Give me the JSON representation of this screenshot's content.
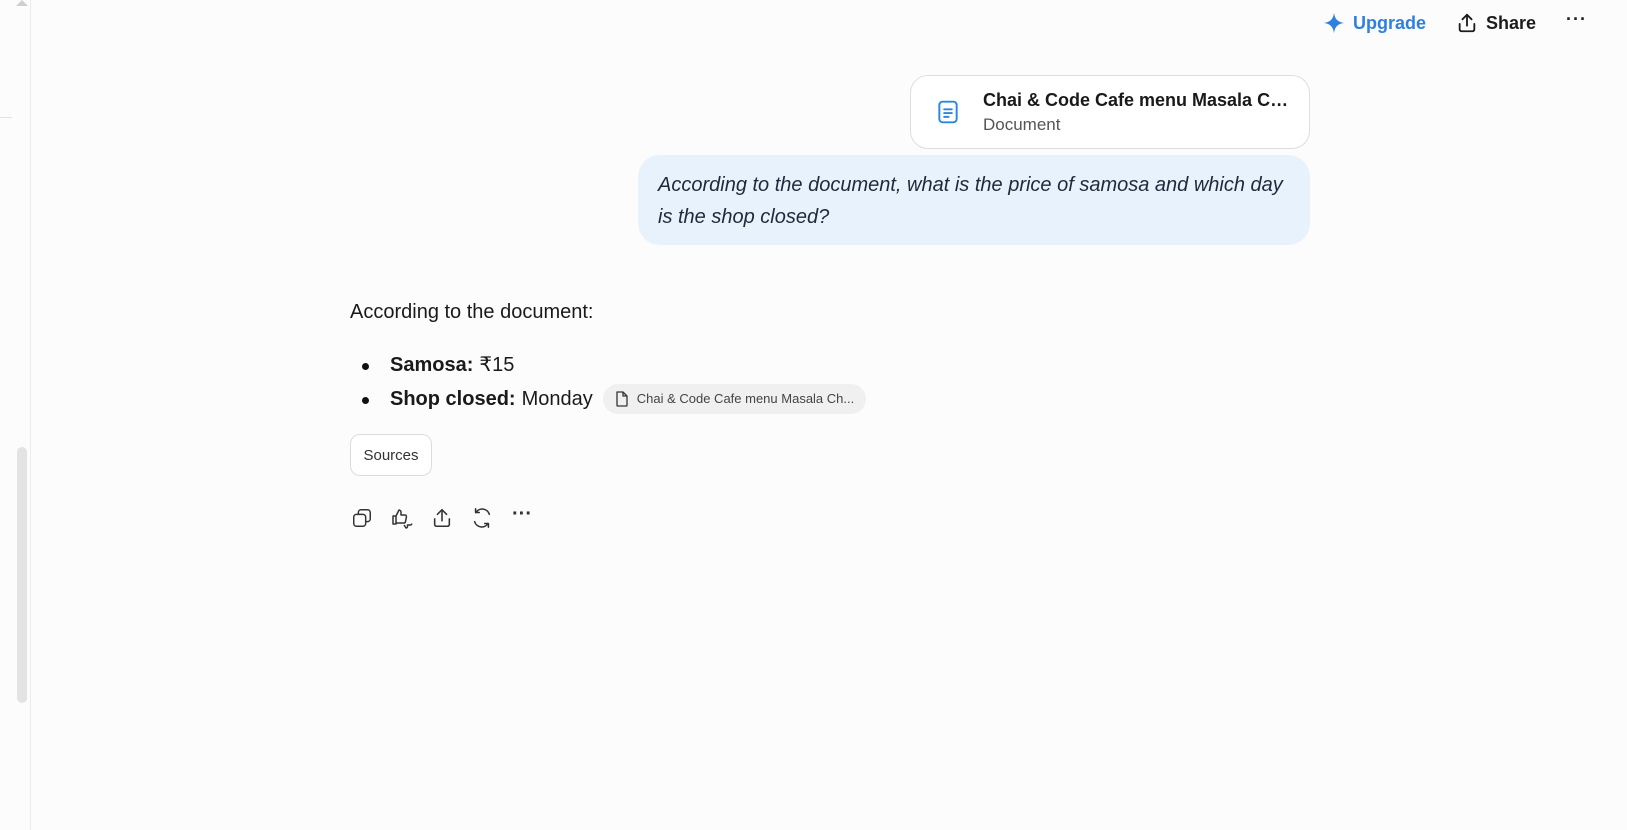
{
  "topbar": {
    "upgrade_label": "Upgrade",
    "share_label": "Share",
    "more_label": "···"
  },
  "attachment": {
    "title": "Chai & Code Cafe menu Masala Chai ...",
    "type": "Document"
  },
  "user_message": {
    "text": "According to the document, what is the price of samosa and which day is the shop closed?"
  },
  "answer": {
    "intro": "According to the document:",
    "items": [
      {
        "label": "Samosa:",
        "value": "₹15"
      },
      {
        "label": "Shop closed:",
        "value": "Monday"
      }
    ],
    "citation_label": "Chai & Code Cafe menu Masala Ch...",
    "sources_label": "Sources"
  },
  "actions": {
    "more_label": "···"
  },
  "colors": {
    "accent": "#2f7fe0",
    "user_bubble": "#e8f2fd",
    "background": "#fcfcfc"
  },
  "icons": [
    "sparkle-icon",
    "share-icon",
    "document-icon",
    "file-icon",
    "copy-icon",
    "thumbs-icon",
    "export-icon",
    "refresh-icon",
    "more-icon"
  ]
}
